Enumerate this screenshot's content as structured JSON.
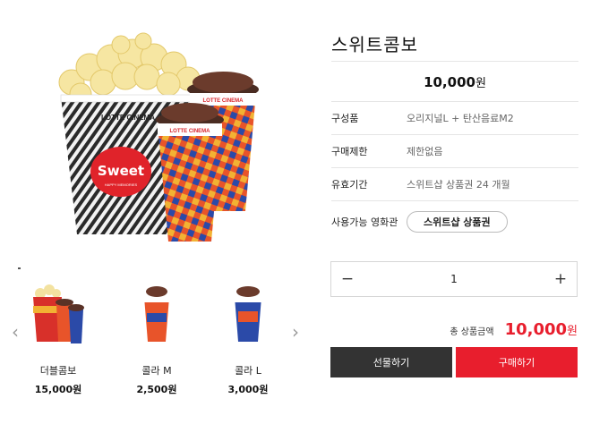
{
  "product": {
    "title": "스위트콤보",
    "price_value": "10,000",
    "price_unit": "원"
  },
  "info": [
    {
      "label": "구성품",
      "value": "오리지널L + 탄산음료M2"
    },
    {
      "label": "구매제한",
      "value": "제한없음"
    },
    {
      "label": "유효기간",
      "value": "스위트샵 상품권 24 개월"
    },
    {
      "label": "사용가능 영화관",
      "value": "스위트샵 상품권"
    }
  ],
  "quantity": {
    "minus": "−",
    "value": "1",
    "plus": "+"
  },
  "total": {
    "label": "총 상품금액",
    "value": "10,000",
    "unit": "원"
  },
  "actions": {
    "gift": "선물하기",
    "buy": "구매하기"
  },
  "thumbnails": [
    {
      "name": "더블콤보",
      "price": "15,000원"
    },
    {
      "name": "콜라 M",
      "price": "2,500원"
    },
    {
      "name": "콜라 L",
      "price": "3,000원"
    }
  ],
  "nav": {
    "prev": "‹",
    "next": "›"
  },
  "image_text": {
    "bucket_brand": "LOTTE CINEMA",
    "bucket_logo": "Sweet",
    "bucket_tagline": "HAPPY MEMORIES",
    "cup_brand": "LOTTE CINEMA"
  },
  "colors": {
    "accent": "#e81e2d",
    "dark": "#333333"
  }
}
